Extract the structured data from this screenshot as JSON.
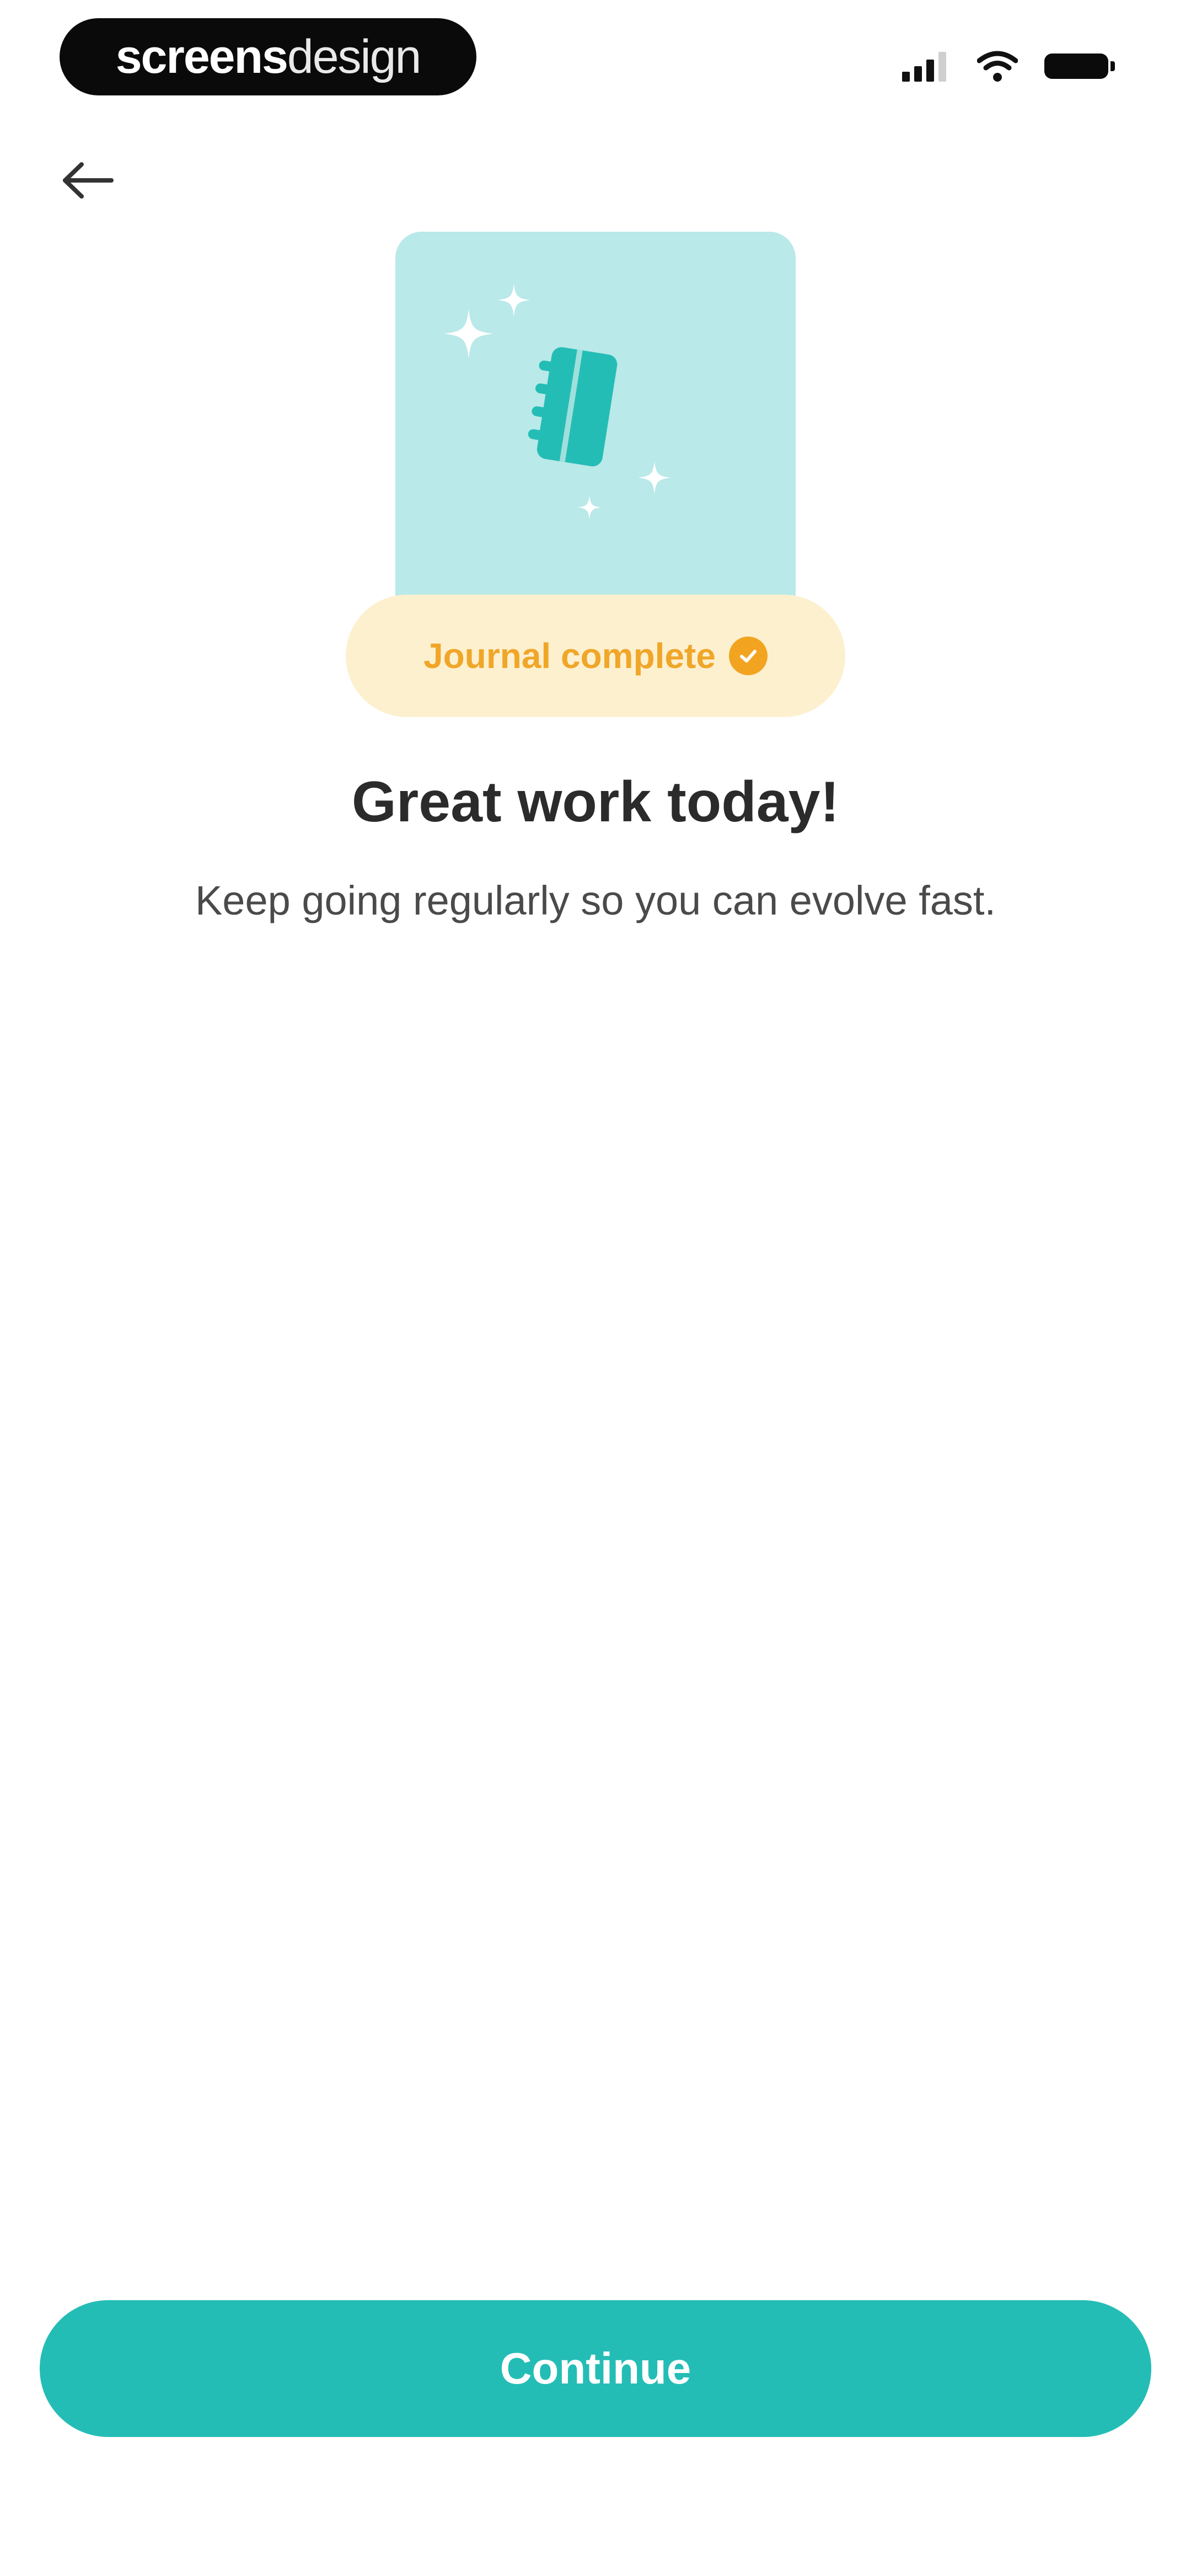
{
  "status_bar": {
    "brand_strong": "screens",
    "brand_light": "design",
    "icons": [
      "signal-icon",
      "wifi-icon",
      "battery-icon"
    ]
  },
  "nav": {
    "back_icon": "arrow-left-icon"
  },
  "illustration": {
    "icon": "journal-notebook-icon",
    "sparkle_icon": "sparkle-icon",
    "background_color": "#b9e9e8",
    "notebook_color": "#24bdb6"
  },
  "badge": {
    "label": "Journal complete",
    "icon": "check-circle-icon",
    "color": "#f0a628",
    "background": "#fdf0cf"
  },
  "content": {
    "title": "Great work today!",
    "subtitle": "Keep going regularly so you can evolve fast."
  },
  "actions": {
    "continue_label": "Continue",
    "accent_color": "#24bdb6"
  }
}
